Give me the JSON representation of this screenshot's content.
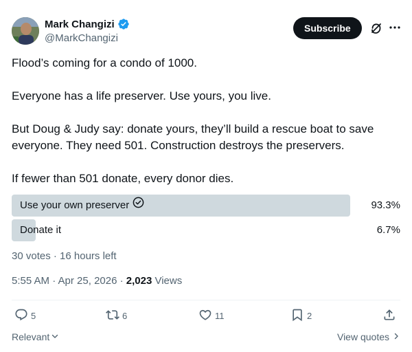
{
  "author": {
    "display_name": "Mark Changizi",
    "handle": "@MarkChangizi",
    "verified": true,
    "avatar_icon": "user-avatar"
  },
  "header": {
    "subscribe_label": "Subscribe",
    "grok_icon": "grok-icon",
    "more_icon": "more-icon"
  },
  "tweet": {
    "paragraphs": [
      "Flood’s coming for a condo of 1000.",
      "Everyone has a life preserver. Use yours, you live.",
      "But Doug & Judy say: donate yours, they’ll build a rescue boat to save everyone. They need 501. Construction destroys the preservers.",
      "If fewer than 501 donate, every donor dies."
    ]
  },
  "poll": {
    "options": [
      {
        "label": "Use your own preserver",
        "percent_text": "93.3%",
        "fraction": 0.933,
        "winner": true
      },
      {
        "label": "Donate it",
        "percent_text": "6.7%",
        "fraction": 0.067,
        "winner": false
      }
    ],
    "meta": "30 votes · 16 hours left"
  },
  "timestamp": {
    "time": "5:55 AM · Apr 25, 2026 · ",
    "views_count": "2,023",
    "views_label": " Views"
  },
  "actions": {
    "replies": "5",
    "reposts": "6",
    "likes": "11",
    "bookmarks": "2"
  },
  "footer": {
    "sort_label": "Relevant",
    "view_quotes_label": "View quotes"
  },
  "colors": {
    "text": "#0f1419",
    "secondary": "#536471",
    "poll_bar": "#cfd9de",
    "verified_blue": "#1d9bf0"
  }
}
